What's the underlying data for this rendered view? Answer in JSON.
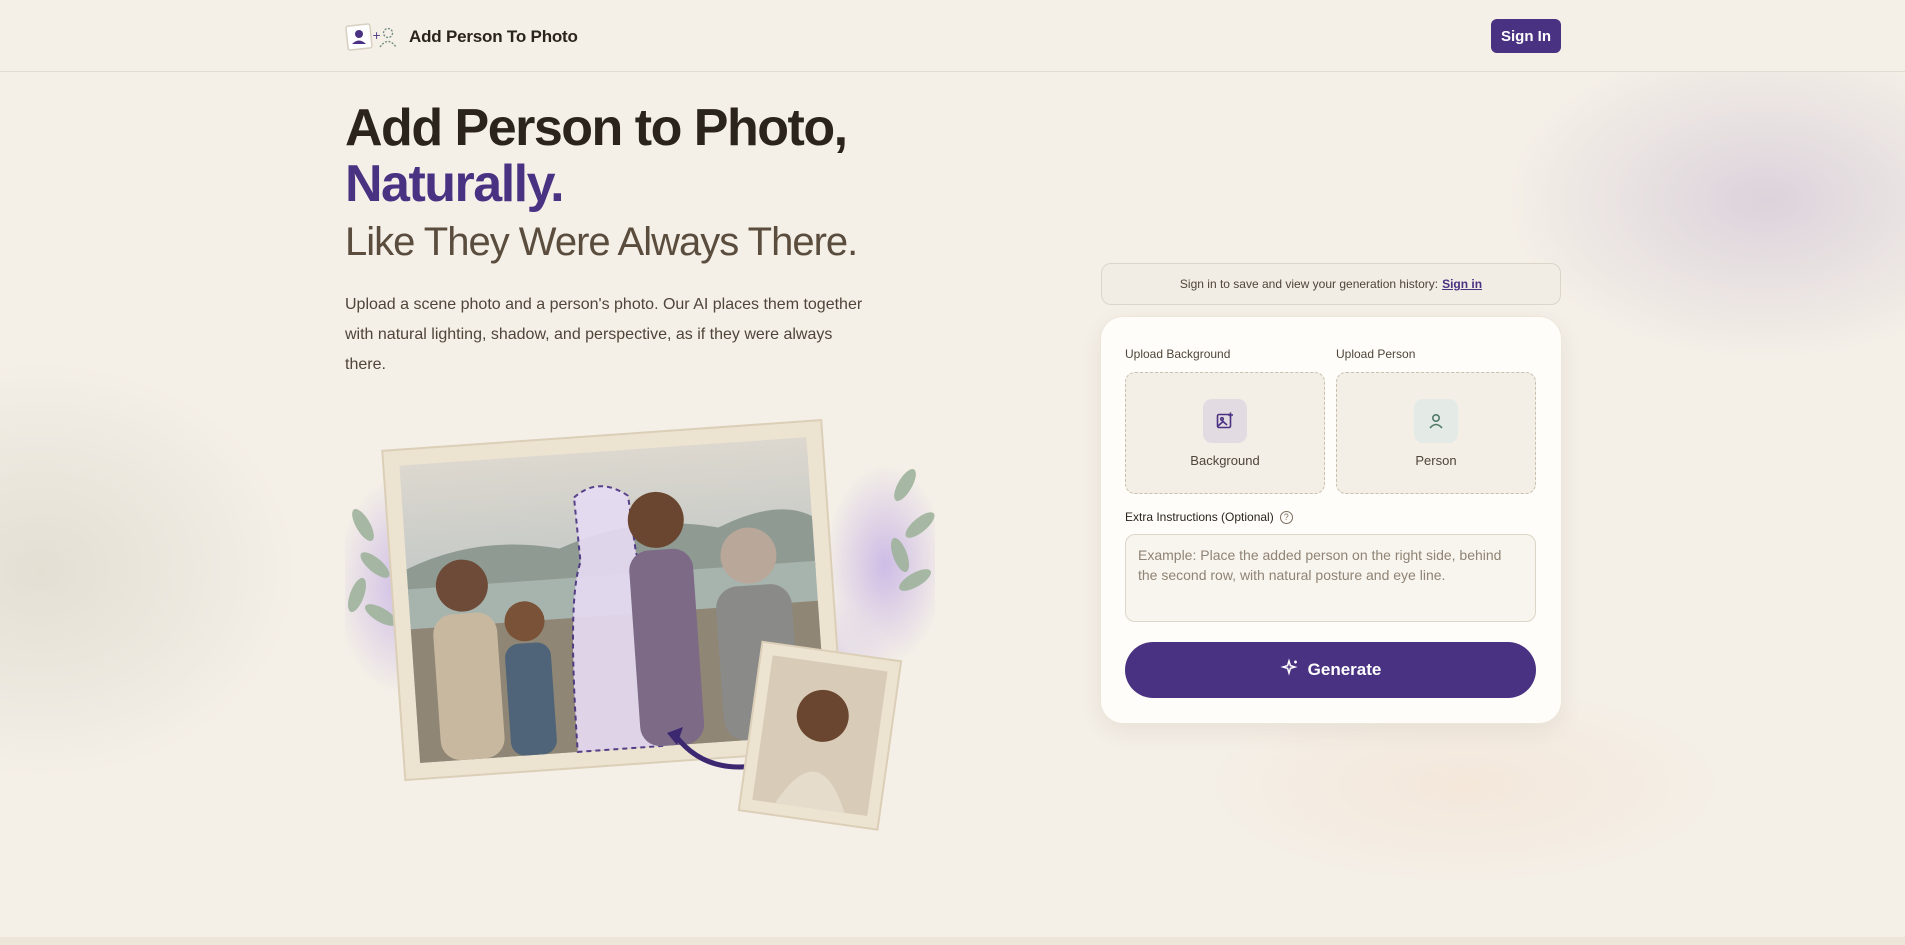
{
  "header": {
    "brand": "Add Person To Photo",
    "signin_label": "Sign In"
  },
  "hero": {
    "title_line1": "Add Person to Photo,",
    "title_line2": "Naturally.",
    "subtitle": "Like They Were Always There.",
    "description": "Upload a scene photo and a person's photo. Our AI places them together with natural lighting, shadow, and perspective, as if they were always there."
  },
  "signin_bar": {
    "text": "Sign in to save and view your generation history:",
    "link": "Sign in"
  },
  "form": {
    "background_label": "Upload Background",
    "background_box": "Background",
    "person_label": "Upload Person",
    "person_box": "Person",
    "extra_label": "Extra Instructions (Optional)",
    "extra_placeholder": "Example: Place the added person on the right side, behind the second row, with natural posture and eye line.",
    "extra_value": "",
    "generate_label": "Generate"
  },
  "icons": {
    "logo": "add-person-logo-icon",
    "help": "help-circle-icon",
    "background_upload": "image-plus-icon",
    "person_upload": "person-icon",
    "generate": "sparkles-icon"
  },
  "colors": {
    "accent": "#4a3283",
    "page_bg": "#f4efe7",
    "person_icon_bg": "#e4ebe6",
    "background_icon_bg": "#e2dbe2"
  }
}
